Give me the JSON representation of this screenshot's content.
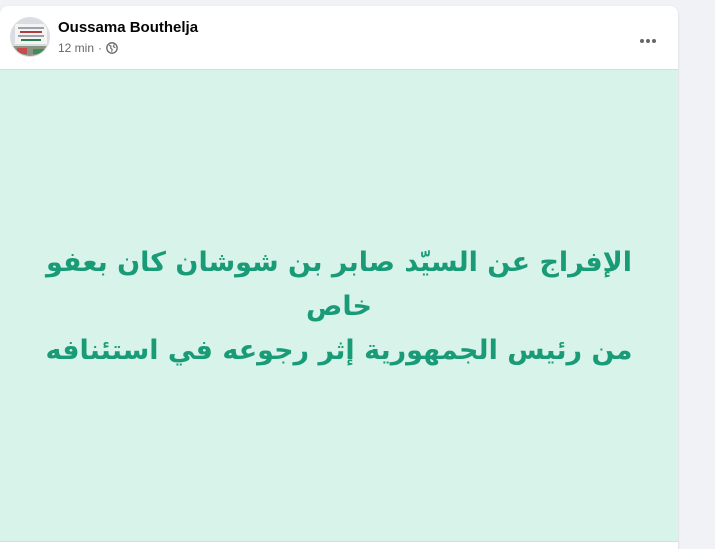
{
  "post": {
    "author": "Oussama Bouthelja",
    "timestamp": "12 min",
    "separator": "·",
    "audience_icon": "globe-icon",
    "more_icon": "more-options-icon",
    "text_line1": "الإفراج عن السيّد صابر بن شوشان كان بعفو خاص",
    "text_line2": "من رئيس الجمهورية إثر رجوعه في استئنافه",
    "background_color": "#d7f3ea",
    "text_color": "#1a9b78"
  }
}
